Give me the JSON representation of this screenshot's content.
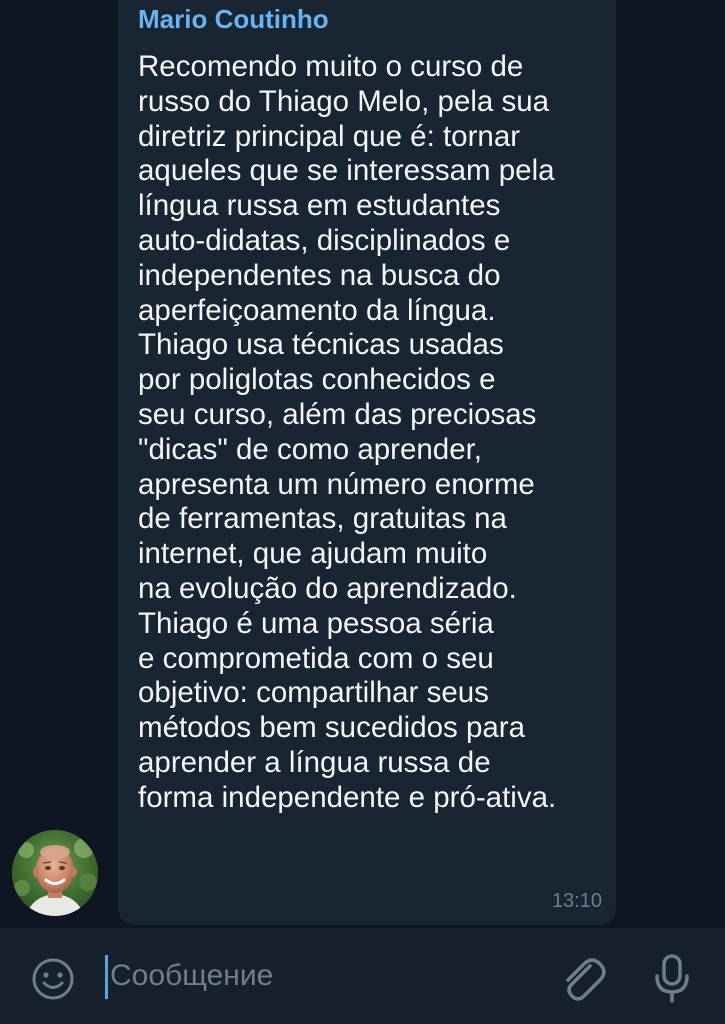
{
  "message": {
    "sender": "Mario Coutinho",
    "lines": [
      "Recomendo muito o curso de",
      "russo do Thiago Melo, pela sua",
      "diretriz principal que é: tornar",
      "aqueles que se interessam pela",
      "língua russa em estudantes",
      "auto-didatas, disciplinados e",
      "independentes na busca do",
      "aperfeiçoamento da língua.",
      "Thiago usa técnicas usadas",
      "por poliglotas conhecidos e",
      "seu curso, além das preciosas",
      "\"dicas\" de como aprender,",
      "apresenta um número enorme",
      "de ferramentas, gratuitas na",
      "internet, que ajudam muito",
      "na evolução do aprendizado.",
      "Thiago é uma pessoa séria",
      "e comprometida com o seu",
      "objetivo: compartilhar seus",
      "métodos bem sucedidos para",
      "aprender a língua russa de",
      "forma independente e pró-ativa."
    ],
    "time": "13:10"
  },
  "input": {
    "placeholder": "Сообщение"
  },
  "icons": {
    "emoji": "smile-icon",
    "attach": "paperclip-icon",
    "mic": "microphone-icon"
  },
  "colors": {
    "background": "#0e1621",
    "bubble": "#182533",
    "input_bar": "#17212b",
    "sender_name": "#6ab3f3",
    "message_text": "#f5f5f5",
    "timestamp": "#6d7f8f",
    "cursor": "#5aa2e6"
  }
}
